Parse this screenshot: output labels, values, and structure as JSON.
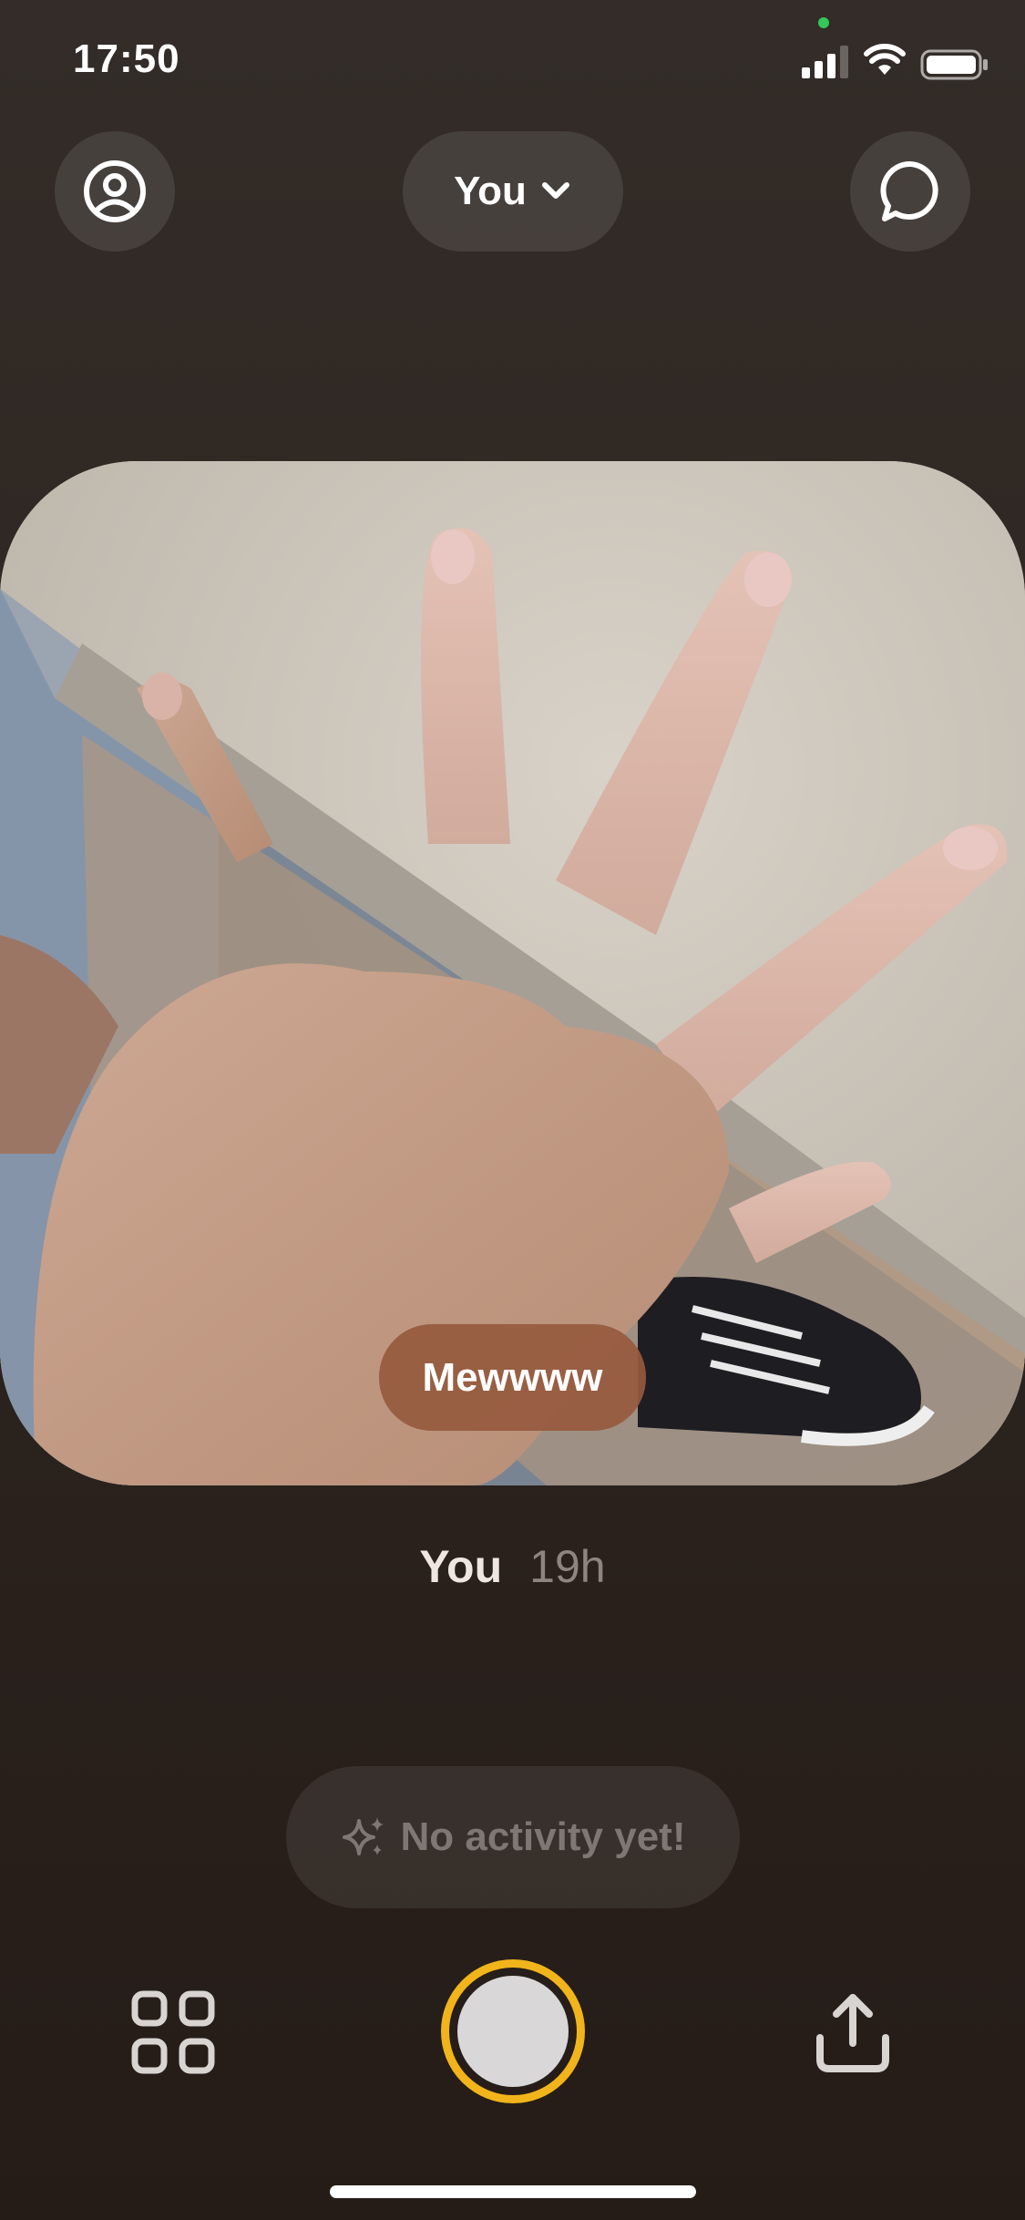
{
  "status_bar": {
    "time": "17:50",
    "icons": [
      "camera-in-use-dot",
      "cellular-signal-icon",
      "wifi-icon",
      "battery-icon"
    ]
  },
  "header": {
    "profile_icon": "profile-circle-icon",
    "friend_selector_label": "You",
    "friend_selector_icon": "chevron-down-icon",
    "chat_icon": "chat-bubble-icon"
  },
  "photo": {
    "description_icon": "photo",
    "caption": "Mewwww"
  },
  "post_meta": {
    "author": "You",
    "time": "19h"
  },
  "activity": {
    "icon": "sparkles-icon",
    "text": "No activity yet!"
  },
  "bottom_bar": {
    "grid_icon": "grid-icon",
    "shutter_icon": "shutter-button",
    "share_icon": "share-icon"
  },
  "colors": {
    "shutter_ring": "#f1b41b",
    "caption_pill": "#965a3e",
    "status_dot": "#34c759"
  }
}
